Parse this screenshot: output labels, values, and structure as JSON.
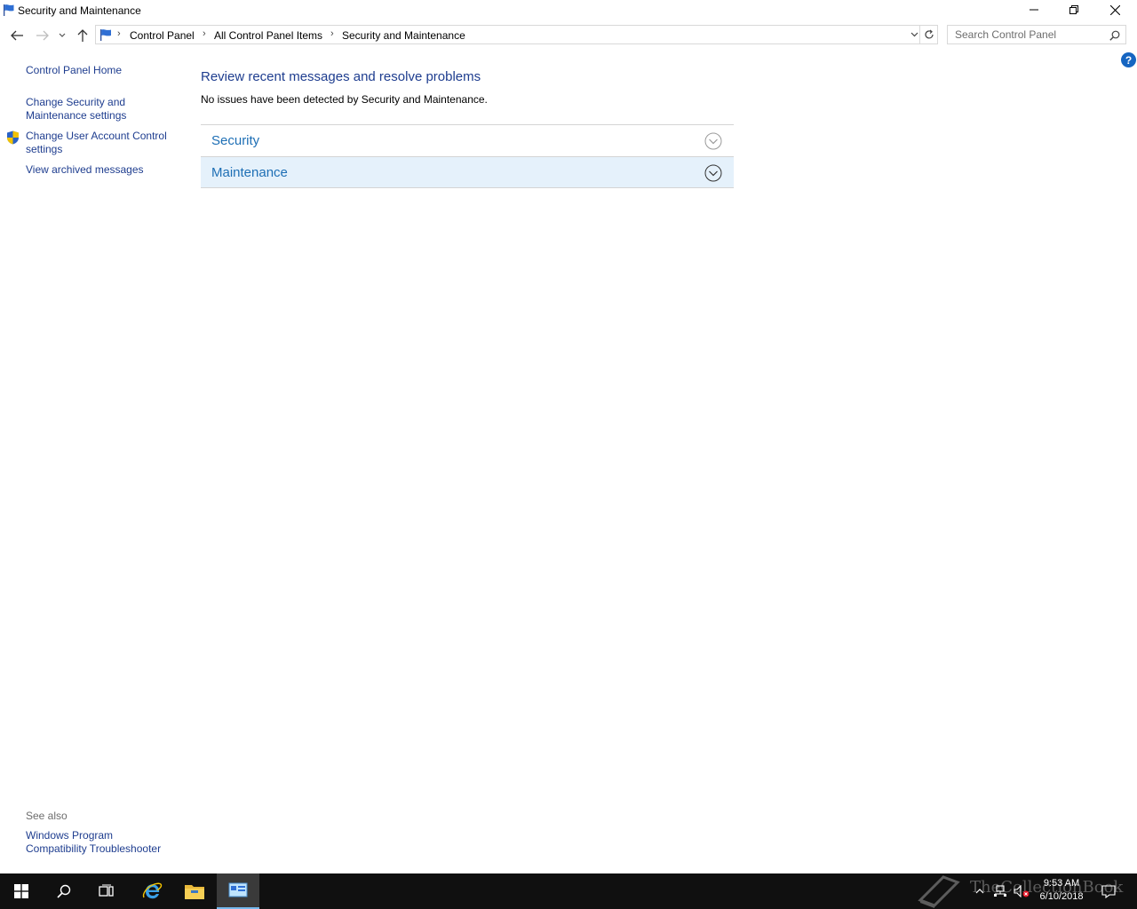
{
  "window": {
    "title": "Security and Maintenance"
  },
  "navigation": {
    "breadcrumbs": [
      "Control Panel",
      "All Control Panel Items",
      "Security and Maintenance"
    ],
    "search_placeholder": "Search Control Panel"
  },
  "sidebar": {
    "home": "Control Panel Home",
    "change_security_line1": "Change Security and",
    "change_security_line2": "Maintenance settings",
    "change_uac_line1": "Change User Account Control",
    "change_uac_line2": "settings",
    "view_archived": "View archived messages",
    "see_also": "See also",
    "compat_line1": "Windows Program",
    "compat_line2": "Compatibility Troubleshooter"
  },
  "main": {
    "title": "Review recent messages and resolve problems",
    "description": "No issues have been detected by Security and Maintenance.",
    "sections": [
      {
        "label": "Security"
      },
      {
        "label": "Maintenance"
      }
    ]
  },
  "taskbar": {
    "time": "9:53 AM",
    "date": "6/10/2018",
    "watermark": "TheCollectionBook"
  },
  "colors": {
    "link": "#1e3d8f",
    "section_text": "#1e6fb5",
    "section_highlight": "#e5f1fb",
    "taskbar": "#101010"
  }
}
